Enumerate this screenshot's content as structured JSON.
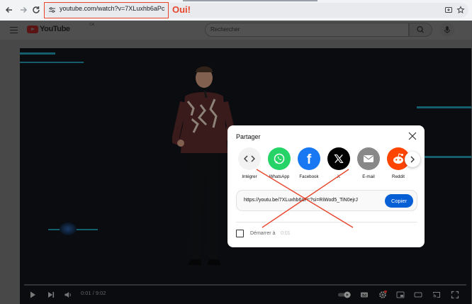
{
  "browser": {
    "url": "youtube.com/watch?v=7XLuxhb6aPc"
  },
  "annotation": {
    "text": "Oui!",
    "color": "#e8452b"
  },
  "youtube": {
    "logo_text": "YouTube",
    "region": "CA",
    "search_placeholder": "Rechercher"
  },
  "player": {
    "current_time": "0:01",
    "duration": "9:02",
    "time_separator": " / "
  },
  "share_dialog": {
    "title": "Partager",
    "targets": [
      {
        "label": "Intégrer",
        "icon": "embed-icon",
        "color": "#f2f2f2"
      },
      {
        "label": "WhatsApp",
        "icon": "whatsapp-icon",
        "color": "#25d366"
      },
      {
        "label": "Facebook",
        "icon": "facebook-icon",
        "color": "#1877f2"
      },
      {
        "label": "X",
        "icon": "x-icon",
        "color": "#000000"
      },
      {
        "label": "E-mail",
        "icon": "email-icon",
        "color": "#888888"
      },
      {
        "label": "Reddit",
        "icon": "reddit-icon",
        "color": "#ff4500"
      }
    ],
    "link": "https://youtu.be/7XLuxhb6aPc?si=RiWod5_TiN0ejrJ",
    "copy_label": "Copier",
    "start_label": "Démarrer à",
    "start_time": "0:01",
    "accent": "#065fd4"
  }
}
